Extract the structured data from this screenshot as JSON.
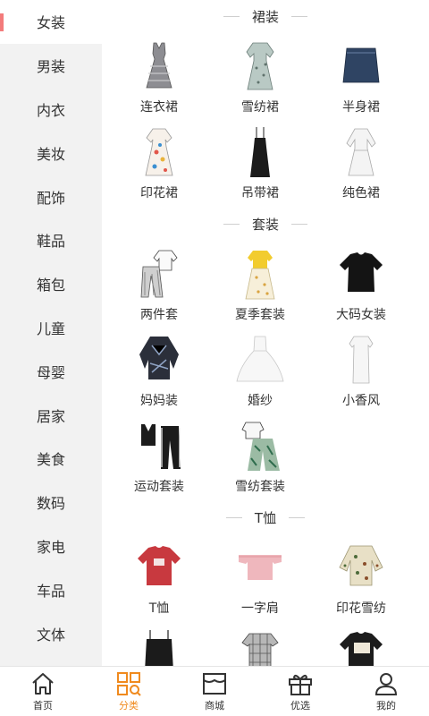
{
  "sidebar": {
    "items": [
      {
        "label": "女装",
        "active": true
      },
      {
        "label": "男装"
      },
      {
        "label": "内衣"
      },
      {
        "label": "美妆"
      },
      {
        "label": "配饰"
      },
      {
        "label": "鞋品"
      },
      {
        "label": "箱包"
      },
      {
        "label": "儿童"
      },
      {
        "label": "母婴"
      },
      {
        "label": "居家"
      },
      {
        "label": "美食"
      },
      {
        "label": "数码"
      },
      {
        "label": "家电"
      },
      {
        "label": "车品"
      },
      {
        "label": "文体"
      }
    ]
  },
  "sections": [
    {
      "title": "裙装",
      "items": [
        {
          "label": "连衣裙",
          "icon": "checked-dress-icon"
        },
        {
          "label": "雪纺裙",
          "icon": "chiffon-dress-icon"
        },
        {
          "label": "半身裙",
          "icon": "denim-skirt-icon"
        },
        {
          "label": "印花裙",
          "icon": "printed-dress-icon"
        },
        {
          "label": "吊带裙",
          "icon": "slip-dress-icon"
        },
        {
          "label": "纯色裙",
          "icon": "white-dress-icon"
        }
      ]
    },
    {
      "title": "套装",
      "items": [
        {
          "label": "两件套",
          "icon": "two-piece-icon"
        },
        {
          "label": "夏季套装",
          "icon": "summer-set-icon"
        },
        {
          "label": "大码女装",
          "icon": "plus-size-tee-icon"
        },
        {
          "label": "妈妈装",
          "icon": "mom-wear-icon"
        },
        {
          "label": "婚纱",
          "icon": "wedding-dress-icon"
        },
        {
          "label": "小香风",
          "icon": "tweed-dress-icon"
        },
        {
          "label": "运动套装",
          "icon": "sport-set-icon"
        },
        {
          "label": "雪纺套装",
          "icon": "chiffon-set-icon"
        }
      ]
    },
    {
      "title": "T恤",
      "items": [
        {
          "label": "T恤",
          "icon": "red-tshirt-icon"
        },
        {
          "label": "一字肩",
          "icon": "off-shoulder-top-icon"
        },
        {
          "label": "印花雪纺",
          "icon": "printed-chiffon-icon"
        },
        {
          "label": "",
          "icon": "black-top-icon"
        },
        {
          "label": "",
          "icon": "plaid-top-icon"
        },
        {
          "label": "",
          "icon": "graphic-tee-icon"
        }
      ]
    }
  ],
  "tabbar": {
    "tabs": [
      {
        "label": "首页",
        "icon": "home-icon"
      },
      {
        "label": "分类",
        "icon": "category-icon",
        "active": true
      },
      {
        "label": "商城",
        "icon": "store-icon"
      },
      {
        "label": "优选",
        "icon": "gift-icon"
      },
      {
        "label": "我的",
        "icon": "user-icon"
      }
    ]
  },
  "colors": {
    "accent": "#f08a1e",
    "sidebar_active_marker": "#f37b7b",
    "sidebar_bg": "#f2f2f2"
  }
}
